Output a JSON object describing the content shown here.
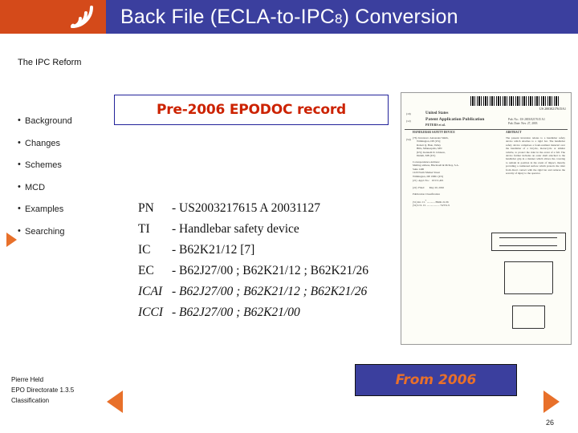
{
  "header": {
    "title_before": "Back File (ECLA-to-IPC",
    "title_sub": "8",
    "title_after": ") Conversion",
    "logo_icon": "epo-waves-logo-icon",
    "bar_color": "#3b3f9e",
    "logo_color": "#d44a1a"
  },
  "sidebar": {
    "title": "The IPC Reform",
    "items": [
      {
        "label": "Background"
      },
      {
        "label": "Changes"
      },
      {
        "label": "Schemes"
      },
      {
        "label": "MCD"
      },
      {
        "label": "Examples"
      },
      {
        "label": "Searching"
      }
    ],
    "active_index": 4,
    "footer": {
      "line1": "Pierre Held",
      "line2": "EPO Directorate 1.3.5",
      "line3": "Classification"
    }
  },
  "main": {
    "record_box_label": "Pre-2006 EPODOC record",
    "record_box_text_color": "#cc2200",
    "record": [
      {
        "key": "PN",
        "italic": false,
        "value": "- US2003217615 A 20031127"
      },
      {
        "key": "TI",
        "italic": false,
        "value": "- Handlebar safety device"
      },
      {
        "key": "IC",
        "italic": false,
        "value": "- B62K21/12 [7]"
      },
      {
        "key": "EC",
        "italic": false,
        "value": "- B62J27/00 ; B62K21/12 ; B62K21/26"
      },
      {
        "key": "ICAI",
        "italic": true,
        "value": "- B62J27/00 ; B62K21/12 ; B62K21/26"
      },
      {
        "key": "ICCI",
        "italic": true,
        "value": "- B62J27/00 ; B62K21/00"
      }
    ],
    "from_label": "From 2006",
    "from_box_color": "#3b3f9e",
    "from_text_color": "#e8702a"
  },
  "document_thumbnail": {
    "name": "us-patent-application-publication-front-page",
    "barcode": "barcode-icon",
    "doc_number": "US 20030217615A1",
    "office_line": "United States",
    "kind_line": "Patent Application Publication",
    "pub_number_label": "Pub. No.: US 2003/0217615 A1",
    "pub_date_label": "Pub. Date:        Nov. 27, 2003",
    "inventor_line": "PETERS et al.",
    "title_line": "HANDLEBAR SAFETY DEVICE",
    "abstract_heading": "ABSTRACT"
  },
  "navigation": {
    "prev_icon": "previous-slide-arrow-icon",
    "next_icon": "next-slide-arrow-icon",
    "page_number": "26"
  }
}
